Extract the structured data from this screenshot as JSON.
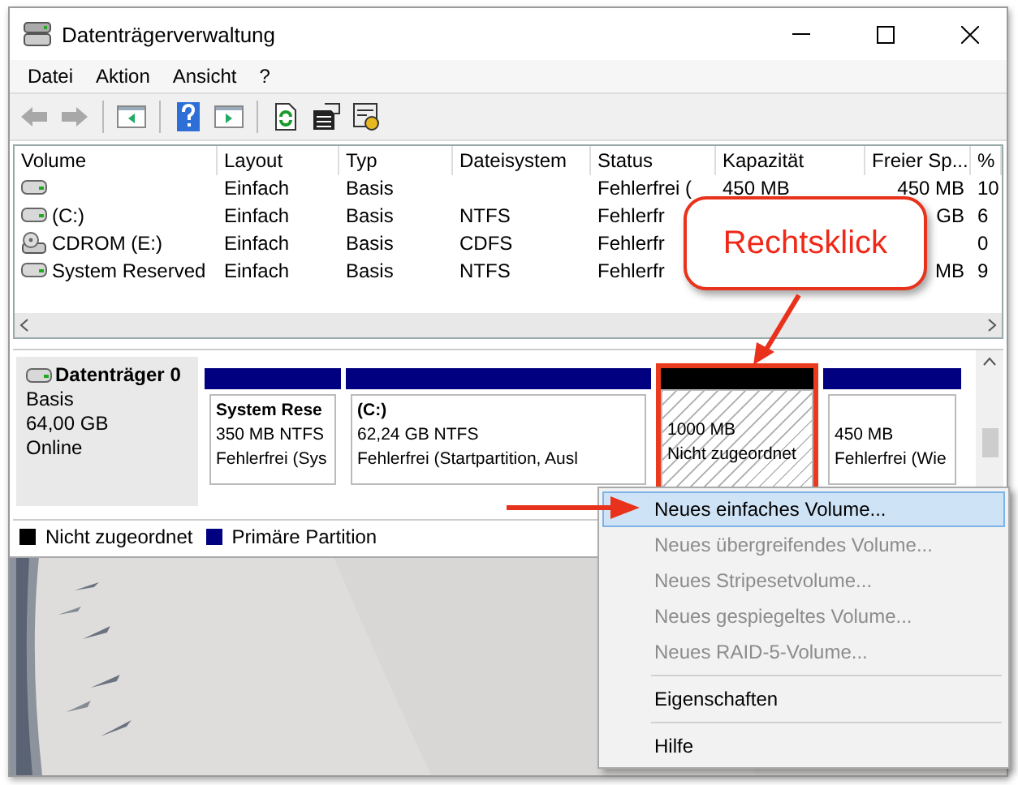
{
  "window": {
    "title": "Datenträgerverwaltung"
  },
  "menu": [
    "Datei",
    "Aktion",
    "Ansicht",
    "?"
  ],
  "toolbar": [
    {
      "kind": "back",
      "disabled": true
    },
    {
      "kind": "forward",
      "disabled": true
    },
    {
      "kind": "sep"
    },
    {
      "kind": "tree"
    },
    {
      "kind": "sep"
    },
    {
      "kind": "help"
    },
    {
      "kind": "panel"
    },
    {
      "kind": "sep"
    },
    {
      "kind": "refresh"
    },
    {
      "kind": "properties"
    },
    {
      "kind": "settings"
    }
  ],
  "table": {
    "columns": [
      "Volume",
      "Layout",
      "Typ",
      "Dateisystem",
      "Status",
      "Kapazität",
      "Freier Sp...",
      "%"
    ],
    "rows": [
      {
        "kind": "drive",
        "cells": [
          null,
          "Einfach",
          "Basis",
          null,
          "Fehlerfrei (",
          "450 MB",
          "450 MB",
          "10"
        ]
      },
      {
        "kind": "drive",
        "cells": [
          "(C:)",
          "Einfach",
          "Basis",
          "NTFS",
          "Fehlerfr",
          null,
          "GB",
          "6"
        ]
      },
      {
        "kind": "cdrom",
        "cells": [
          "CDROM (E:)",
          "Einfach",
          "Basis",
          "CDFS",
          "Fehlerfr",
          null,
          null,
          "0"
        ]
      },
      {
        "kind": "drive",
        "cells": [
          "System Reserved",
          "Einfach",
          "Basis",
          "NTFS",
          "Fehlerfr",
          null,
          "MB",
          "9"
        ]
      }
    ]
  },
  "disk": {
    "name": "Datenträger 0",
    "lines": [
      "Basis",
      "64,00 GB",
      "Online"
    ],
    "partitions": [
      {
        "kind": "primary",
        "selected": false,
        "title": "System Rese",
        "lines": [
          "350 MB NTFS",
          "Fehlerfrei (Sys"
        ]
      },
      {
        "kind": "primary",
        "selected": false,
        "title": "(C:)",
        "lines": [
          "62,24 GB NTFS",
          "Fehlerfrei (Startpartition, Ausl"
        ]
      },
      {
        "kind": "unallocated",
        "selected": true,
        "lines": [
          "1000 MB",
          "Nicht zugeordnet"
        ]
      },
      {
        "kind": "primary",
        "selected": false,
        "lines": [
          "450 MB",
          "Fehlerfrei (Wie"
        ]
      }
    ]
  },
  "legend": [
    {
      "label": "Nicht zugeordnet",
      "color": "#000000"
    },
    {
      "label": "Primäre Partition",
      "color": "#000080"
    }
  ],
  "callout": {
    "text": "Rechtsklick"
  },
  "context_menu": {
    "groups": [
      [
        {
          "label": "Neues einfaches Volume...",
          "disabled": false,
          "selected": true
        },
        {
          "label": "Neues übergreifendes Volume...",
          "disabled": true,
          "selected": false
        },
        {
          "label": "Neues Stripesetvolume...",
          "disabled": true,
          "selected": false
        },
        {
          "label": "Neues gespiegeltes Volume...",
          "disabled": true,
          "selected": false
        },
        {
          "label": "Neues RAID-5-Volume...",
          "disabled": true,
          "selected": false
        }
      ],
      [
        {
          "label": "Eigenschaften",
          "disabled": false,
          "selected": false
        }
      ],
      [
        {
          "label": "Hilfe",
          "disabled": false,
          "selected": false
        }
      ]
    ]
  }
}
